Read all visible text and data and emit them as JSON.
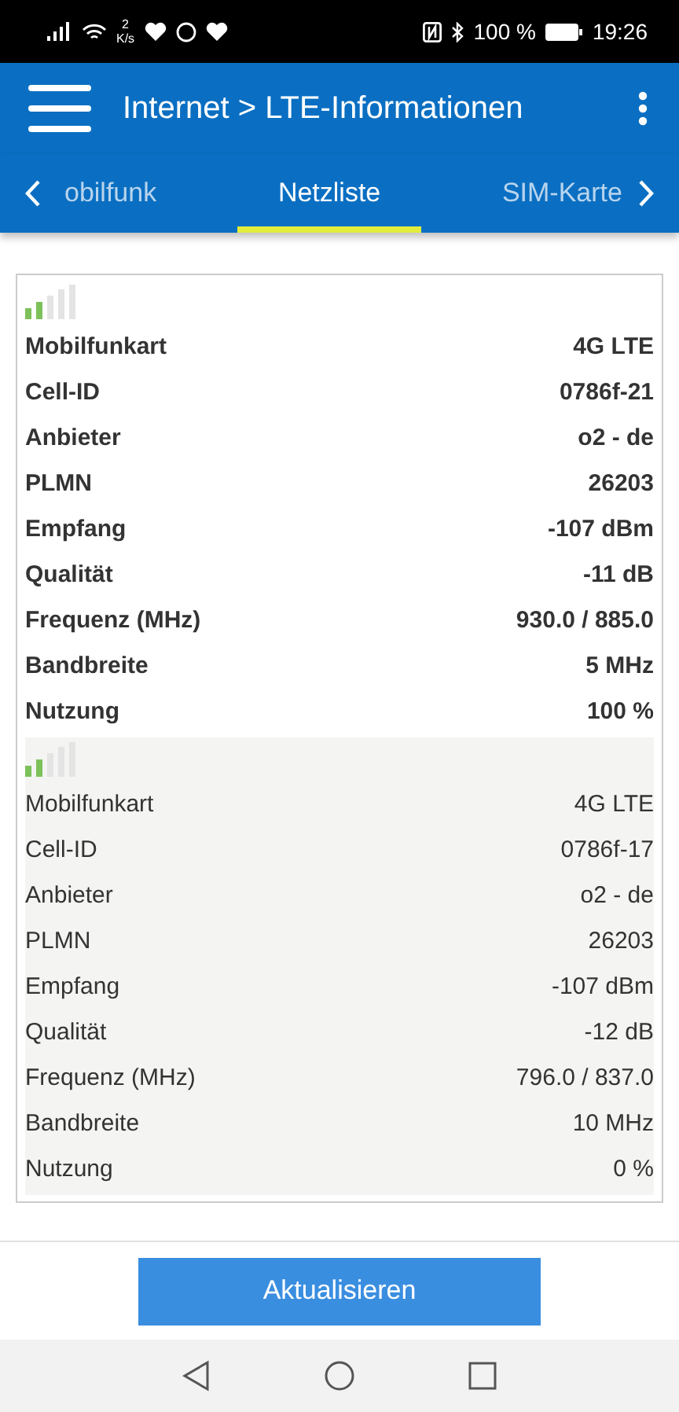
{
  "status_bar": {
    "speed_value": "2",
    "speed_unit": "K/s",
    "battery": "100 %",
    "time": "19:26"
  },
  "header": {
    "title": "Internet > LTE-Informationen"
  },
  "tabs": [
    {
      "label": "obilfunk",
      "selected": false
    },
    {
      "label": "Netzliste",
      "selected": true
    },
    {
      "label": "SIM-Karte",
      "selected": false
    }
  ],
  "cells": [
    {
      "selected": true,
      "rows": [
        [
          "Mobilfunkart",
          "4G LTE"
        ],
        [
          "Cell-ID",
          "0786f-21"
        ],
        [
          "Anbieter",
          "o2 - de"
        ],
        [
          "PLMN",
          "26203"
        ],
        [
          "Empfang",
          "-107 dBm"
        ],
        [
          "Qualität",
          "-11 dB"
        ],
        [
          "Frequenz (MHz)",
          "930.0 / 885.0"
        ],
        [
          "Bandbreite",
          "5 MHz"
        ],
        [
          "Nutzung",
          "100 %"
        ]
      ]
    },
    {
      "selected": false,
      "rows": [
        [
          "Mobilfunkart",
          "4G LTE"
        ],
        [
          "Cell-ID",
          "0786f-17"
        ],
        [
          "Anbieter",
          "o2 - de"
        ],
        [
          "PLMN",
          "26203"
        ],
        [
          "Empfang",
          "-107 dBm"
        ],
        [
          "Qualität",
          "-12 dB"
        ],
        [
          "Frequenz (MHz)",
          "796.0 / 837.0"
        ],
        [
          "Bandbreite",
          "10 MHz"
        ],
        [
          "Nutzung",
          "0 %"
        ]
      ]
    }
  ],
  "buttons": [
    "Aktualisieren"
  ]
}
